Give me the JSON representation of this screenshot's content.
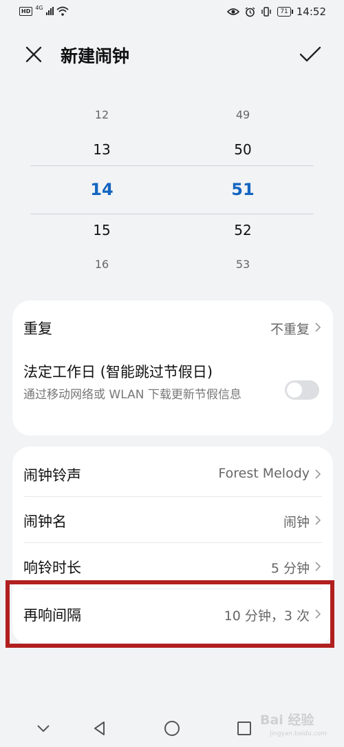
{
  "status_bar": {
    "hd_label": "HD",
    "network_label": "4G",
    "battery_level": "71",
    "time": "14:52",
    "icons": [
      "eye-icon",
      "alarm-icon",
      "vibrate-icon"
    ]
  },
  "header": {
    "title": "新建闹钟"
  },
  "time_picker": {
    "hours": [
      "12",
      "13",
      "14",
      "15",
      "16"
    ],
    "minutes": [
      "49",
      "50",
      "51",
      "52",
      "53"
    ],
    "selected_hour": "14",
    "selected_minute": "51",
    "accent_color": "#1565c0"
  },
  "repeat_card": {
    "repeat_label": "重复",
    "repeat_value": "不重复",
    "workday_label": "法定工作日 (智能跳过节假日)",
    "workday_desc": "通过移动网络或 WLAN 下载更新节假信息",
    "workday_toggle_on": false
  },
  "settings_card": {
    "rows": [
      {
        "label": "闹钟铃声",
        "value": "Forest Melody"
      },
      {
        "label": "闹钟名",
        "value": "闹钟"
      },
      {
        "label": "响铃时长",
        "value": "5 分钟"
      },
      {
        "label": "再响间隔",
        "value": "10 分钟，3 次"
      }
    ]
  },
  "annotation": {
    "highlight_color": "#b11f1f"
  },
  "nav_bar": {
    "icons": [
      "chevron-down-icon",
      "back-icon",
      "home-icon",
      "recents-icon"
    ]
  },
  "watermark": {
    "text": "Bai 经验",
    "sub": "jingyan.baidu.com"
  }
}
